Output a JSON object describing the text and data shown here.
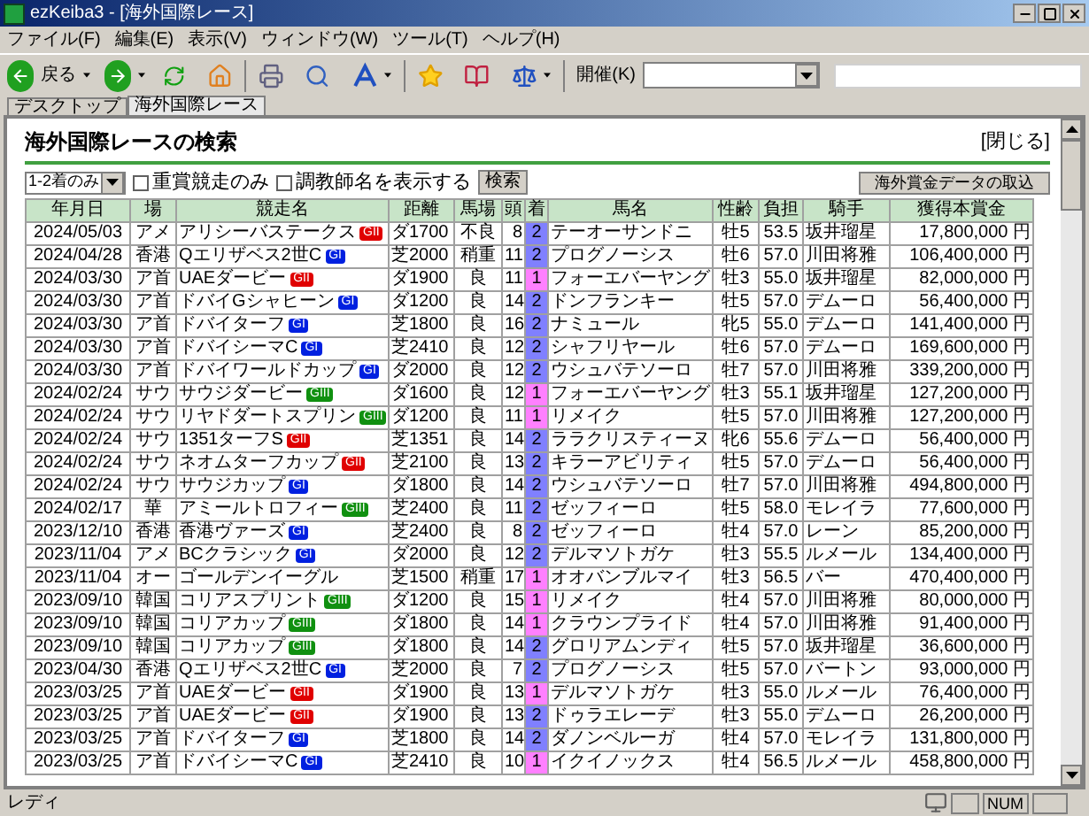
{
  "window": {
    "title": "ezKeiba3 - [海外国際レース]"
  },
  "menu": [
    "ファイル(F)",
    "編集(E)",
    "表示(V)",
    "ウィンドウ(W)",
    "ツール(T)",
    "ヘルプ(H)"
  ],
  "toolbar": {
    "back": "戻る",
    "kaisai_label": "開催(K)"
  },
  "tabs": [
    {
      "label": "デスクトップ",
      "selected": false
    },
    {
      "label": "海外国際レース",
      "selected": true
    }
  ],
  "page": {
    "heading": "海外国際レースの検索",
    "close": "[閉じる]",
    "filter": "1-2着のみ",
    "checkboxes": [
      {
        "label": "重賞競走のみ",
        "checked": false
      },
      {
        "label": "調教師名を表示する",
        "checked": false
      }
    ],
    "search_button": "検索",
    "import_button": "海外賞金データの取込"
  },
  "table": {
    "columns": [
      "年月日",
      "場",
      "競走名",
      "距離",
      "馬場",
      "頭",
      "着",
      "馬名",
      "性齢",
      "負担",
      "騎手",
      "獲得本賞金"
    ],
    "rows": [
      {
        "date": "2024/05/03",
        "venue": "アメ",
        "race": "アリシーバステークス",
        "grade": {
          "label": "GII",
          "color": "#e00000"
        },
        "distance": "ダ1700",
        "track": "不良",
        "runners": "8",
        "finish": {
          "label": "2",
          "color": "#8080ff"
        },
        "horse": "テーオーサンドニ",
        "sex_age": "牡5",
        "weight": "53.5",
        "jockey": "坂井瑠星",
        "prize": "17,800,000 円"
      },
      {
        "date": "2024/04/28",
        "venue": "香港",
        "race": "Qエリザベス2世C",
        "grade": {
          "label": "GI",
          "color": "#0020e0"
        },
        "distance": "芝2000",
        "track": "稍重",
        "runners": "11",
        "finish": {
          "label": "2",
          "color": "#8080ff"
        },
        "horse": "プログノーシス",
        "sex_age": "牡6",
        "weight": "57.0",
        "jockey": "川田将雅",
        "prize": "106,400,000 円"
      },
      {
        "date": "2024/03/30",
        "venue": "ア首",
        "race": "UAEダービー",
        "grade": {
          "label": "GII",
          "color": "#e00000"
        },
        "distance": "ダ1900",
        "track": "良",
        "runners": "11",
        "finish": {
          "label": "1",
          "color": "#ff80ff"
        },
        "horse": "フォーエバーヤング",
        "sex_age": "牡3",
        "weight": "55.0",
        "jockey": "坂井瑠星",
        "prize": "82,000,000 円"
      },
      {
        "date": "2024/03/30",
        "venue": "ア首",
        "race": "ドバイGシャヒーン",
        "grade": {
          "label": "GI",
          "color": "#0020e0"
        },
        "distance": "ダ1200",
        "track": "良",
        "runners": "14",
        "finish": {
          "label": "2",
          "color": "#8080ff"
        },
        "horse": "ドンフランキー",
        "sex_age": "牡5",
        "weight": "57.0",
        "jockey": "デムーロ",
        "prize": "56,400,000 円"
      },
      {
        "date": "2024/03/30",
        "venue": "ア首",
        "race": "ドバイターフ",
        "grade": {
          "label": "GI",
          "color": "#0020e0"
        },
        "distance": "芝1800",
        "track": "良",
        "runners": "16",
        "finish": {
          "label": "2",
          "color": "#8080ff"
        },
        "horse": "ナミュール",
        "sex_age": "牝5",
        "weight": "55.0",
        "jockey": "デムーロ",
        "prize": "141,400,000 円"
      },
      {
        "date": "2024/03/30",
        "venue": "ア首",
        "race": "ドバイシーマC",
        "grade": {
          "label": "GI",
          "color": "#0020e0"
        },
        "distance": "芝2410",
        "track": "良",
        "runners": "12",
        "finish": {
          "label": "2",
          "color": "#8080ff"
        },
        "horse": "シャフリヤール",
        "sex_age": "牡6",
        "weight": "57.0",
        "jockey": "デムーロ",
        "prize": "169,600,000 円"
      },
      {
        "date": "2024/03/30",
        "venue": "ア首",
        "race": "ドバイワールドカップ",
        "grade": {
          "label": "GI",
          "color": "#0020e0"
        },
        "distance": "ダ2000",
        "track": "良",
        "runners": "12",
        "finish": {
          "label": "2",
          "color": "#8080ff"
        },
        "horse": "ウシュバテソーロ",
        "sex_age": "牡7",
        "weight": "57.0",
        "jockey": "川田将雅",
        "prize": "339,200,000 円"
      },
      {
        "date": "2024/02/24",
        "venue": "サウ",
        "race": "サウジダービー",
        "grade": {
          "label": "GIII",
          "color": "#109010"
        },
        "distance": "ダ1600",
        "track": "良",
        "runners": "12",
        "finish": {
          "label": "1",
          "color": "#ff80ff"
        },
        "horse": "フォーエバーヤング",
        "sex_age": "牡3",
        "weight": "55.1",
        "jockey": "坂井瑠星",
        "prize": "127,200,000 円"
      },
      {
        "date": "2024/02/24",
        "venue": "サウ",
        "race": "リヤドダートスプリン",
        "grade": {
          "label": "GIII",
          "color": "#109010"
        },
        "distance": "ダ1200",
        "track": "良",
        "runners": "11",
        "finish": {
          "label": "1",
          "color": "#ff80ff"
        },
        "horse": "リメイク",
        "sex_age": "牡5",
        "weight": "57.0",
        "jockey": "川田将雅",
        "prize": "127,200,000 円"
      },
      {
        "date": "2024/02/24",
        "venue": "サウ",
        "race": "1351ターフS",
        "grade": {
          "label": "GII",
          "color": "#e00000"
        },
        "distance": "芝1351",
        "track": "良",
        "runners": "14",
        "finish": {
          "label": "2",
          "color": "#8080ff"
        },
        "horse": "ララクリスティーヌ",
        "sex_age": "牝6",
        "weight": "55.6",
        "jockey": "デムーロ",
        "prize": "56,400,000 円"
      },
      {
        "date": "2024/02/24",
        "venue": "サウ",
        "race": "ネオムターフカップ",
        "grade": {
          "label": "GII",
          "color": "#e00000"
        },
        "distance": "芝2100",
        "track": "良",
        "runners": "13",
        "finish": {
          "label": "2",
          "color": "#8080ff"
        },
        "horse": "キラーアビリティ",
        "sex_age": "牡5",
        "weight": "57.0",
        "jockey": "デムーロ",
        "prize": "56,400,000 円"
      },
      {
        "date": "2024/02/24",
        "venue": "サウ",
        "race": "サウジカップ",
        "grade": {
          "label": "GI",
          "color": "#0020e0"
        },
        "distance": "ダ1800",
        "track": "良",
        "runners": "14",
        "finish": {
          "label": "2",
          "color": "#8080ff"
        },
        "horse": "ウシュバテソーロ",
        "sex_age": "牡7",
        "weight": "57.0",
        "jockey": "川田将雅",
        "prize": "494,800,000 円"
      },
      {
        "date": "2024/02/17",
        "venue": "華",
        "race": "アミールトロフィー",
        "grade": {
          "label": "GIII",
          "color": "#109010"
        },
        "distance": "芝2400",
        "track": "良",
        "runners": "11",
        "finish": {
          "label": "2",
          "color": "#8080ff"
        },
        "horse": "ゼッフィーロ",
        "sex_age": "牡5",
        "weight": "58.0",
        "jockey": "モレイラ",
        "prize": "77,600,000 円"
      },
      {
        "date": "2023/12/10",
        "venue": "香港",
        "race": "香港ヴァーズ",
        "grade": {
          "label": "GI",
          "color": "#0020e0"
        },
        "distance": "芝2400",
        "track": "良",
        "runners": "8",
        "finish": {
          "label": "2",
          "color": "#8080ff"
        },
        "horse": "ゼッフィーロ",
        "sex_age": "牡4",
        "weight": "57.0",
        "jockey": "レーン",
        "prize": "85,200,000 円"
      },
      {
        "date": "2023/11/04",
        "venue": "アメ",
        "race": "BCクラシック",
        "grade": {
          "label": "GI",
          "color": "#0020e0"
        },
        "distance": "ダ2000",
        "track": "良",
        "runners": "12",
        "finish": {
          "label": "2",
          "color": "#8080ff"
        },
        "horse": "デルマソトガケ",
        "sex_age": "牡3",
        "weight": "55.5",
        "jockey": "ルメール",
        "prize": "134,400,000 円"
      },
      {
        "date": "2023/11/04",
        "venue": "オー",
        "race": "ゴールデンイーグル",
        "distance": "芝1500",
        "track": "稍重",
        "runners": "17",
        "finish": {
          "label": "1",
          "color": "#ff80ff"
        },
        "horse": "オオバンブルマイ",
        "sex_age": "牡3",
        "weight": "56.5",
        "jockey": "バー",
        "prize": "470,400,000 円"
      },
      {
        "date": "2023/09/10",
        "venue": "韓国",
        "race": "コリアスプリント",
        "grade": {
          "label": "GIII",
          "color": "#109010"
        },
        "distance": "ダ1200",
        "track": "良",
        "runners": "15",
        "finish": {
          "label": "1",
          "color": "#ff80ff"
        },
        "horse": "リメイク",
        "sex_age": "牡4",
        "weight": "57.0",
        "jockey": "川田将雅",
        "prize": "80,000,000 円"
      },
      {
        "date": "2023/09/10",
        "venue": "韓国",
        "race": "コリアカップ",
        "grade": {
          "label": "GIII",
          "color": "#109010"
        },
        "distance": "ダ1800",
        "track": "良",
        "runners": "14",
        "finish": {
          "label": "1",
          "color": "#ff80ff"
        },
        "horse": "クラウンプライド",
        "sex_age": "牡4",
        "weight": "57.0",
        "jockey": "川田将雅",
        "prize": "91,400,000 円"
      },
      {
        "date": "2023/09/10",
        "venue": "韓国",
        "race": "コリアカップ",
        "grade": {
          "label": "GIII",
          "color": "#109010"
        },
        "distance": "ダ1800",
        "track": "良",
        "runners": "14",
        "finish": {
          "label": "2",
          "color": "#8080ff"
        },
        "horse": "グロリアムンディ",
        "sex_age": "牡5",
        "weight": "57.0",
        "jockey": "坂井瑠星",
        "prize": "36,600,000 円"
      },
      {
        "date": "2023/04/30",
        "venue": "香港",
        "race": "Qエリザベス2世C",
        "grade": {
          "label": "GI",
          "color": "#0020e0"
        },
        "distance": "芝2000",
        "track": "良",
        "runners": "7",
        "finish": {
          "label": "2",
          "color": "#8080ff"
        },
        "horse": "プログノーシス",
        "sex_age": "牡5",
        "weight": "57.0",
        "jockey": "バートン",
        "prize": "93,000,000 円"
      },
      {
        "date": "2023/03/25",
        "venue": "ア首",
        "race": "UAEダービー",
        "grade": {
          "label": "GII",
          "color": "#e00000"
        },
        "distance": "ダ1900",
        "track": "良",
        "runners": "13",
        "finish": {
          "label": "1",
          "color": "#ff80ff"
        },
        "horse": "デルマソトガケ",
        "sex_age": "牡3",
        "weight": "55.0",
        "jockey": "ルメール",
        "prize": "76,400,000 円"
      },
      {
        "date": "2023/03/25",
        "venue": "ア首",
        "race": "UAEダービー",
        "grade": {
          "label": "GII",
          "color": "#e00000"
        },
        "distance": "ダ1900",
        "track": "良",
        "runners": "13",
        "finish": {
          "label": "2",
          "color": "#8080ff"
        },
        "horse": "ドゥラエレーデ",
        "sex_age": "牡3",
        "weight": "55.0",
        "jockey": "デムーロ",
        "prize": "26,200,000 円"
      },
      {
        "date": "2023/03/25",
        "venue": "ア首",
        "race": "ドバイターフ",
        "grade": {
          "label": "GI",
          "color": "#0020e0"
        },
        "distance": "芝1800",
        "track": "良",
        "runners": "14",
        "finish": {
          "label": "2",
          "color": "#8080ff"
        },
        "horse": "ダノンベルーガ",
        "sex_age": "牡4",
        "weight": "57.0",
        "jockey": "モレイラ",
        "prize": "131,800,000 円"
      },
      {
        "date": "2023/03/25",
        "venue": "ア首",
        "race": "ドバイシーマC",
        "grade": {
          "label": "GI",
          "color": "#0020e0"
        },
        "distance": "芝2410",
        "track": "良",
        "runners": "10",
        "finish": {
          "label": "1",
          "color": "#ff80ff"
        },
        "horse": "イクイノックス",
        "sex_age": "牡4",
        "weight": "56.5",
        "jockey": "ルメール",
        "prize": "458,800,000 円"
      }
    ]
  },
  "status_bar": {
    "text": "レディ",
    "num": "NUM"
  }
}
